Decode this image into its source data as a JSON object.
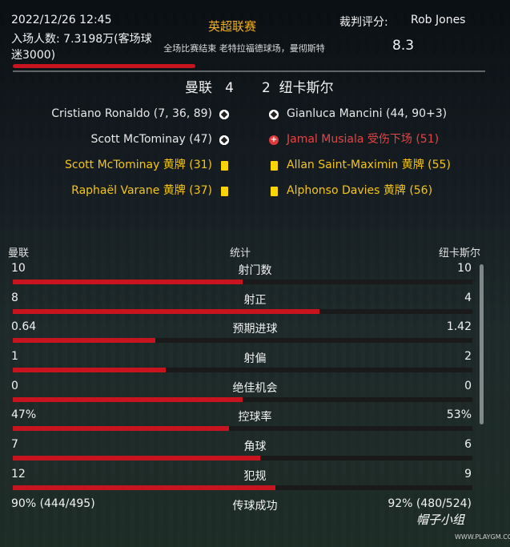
{
  "header": {
    "date_time": "2022/12/26 12:45",
    "attendance": "入场人数: 7.3198万(客场球迷3000)",
    "competition": "英超联赛",
    "subtitle": "全场比赛结束 老特拉福德球场，曼彻斯特",
    "referee_label": "裁判评分:",
    "referee_name": "Rob Jones",
    "referee_rating": "8.3"
  },
  "score": {
    "home_team": "曼联",
    "home_goals": "4",
    "away_goals": "2",
    "away_team": "纽卡斯尔"
  },
  "events": {
    "home": [
      {
        "text": "Cristiano Ronaldo (7, 36, 89)",
        "type": "goal-icon"
      },
      {
        "text": "Scott McTominay (47)",
        "type": "goal-icon"
      },
      {
        "text": "Scott McTominay 黄牌 (31)",
        "type": "yellow-card-icon"
      },
      {
        "text": "Raphaël Varane 黄牌 (37)",
        "type": "yellow-card-icon"
      }
    ],
    "away": [
      {
        "text": "Gianluca Mancini (44, 90+3)",
        "type": "goal-icon"
      },
      {
        "text": "Jamal Musiala 受伤下场 (51)",
        "type": "injury-icon"
      },
      {
        "text": "Allan Saint-Maximin 黄牌 (55)",
        "type": "yellow-card-icon"
      },
      {
        "text": "Alphonso Davies 黄牌 (56)",
        "type": "yellow-card-icon"
      }
    ]
  },
  "stats": {
    "home_label": "曼联",
    "title": "统计",
    "away_label": "纽卡斯尔",
    "rows": [
      {
        "label": "射门数",
        "home": "10",
        "away": "10",
        "home_share": 0.5
      },
      {
        "label": "射正",
        "home": "8",
        "away": "4",
        "home_share": 0.667
      },
      {
        "label": "预期进球",
        "home": "0.64",
        "away": "1.42",
        "home_share": 0.31
      },
      {
        "label": "射偏",
        "home": "1",
        "away": "2",
        "home_share": 0.333
      },
      {
        "label": "绝佳机会",
        "home": "0",
        "away": "0",
        "home_share": 0.5
      },
      {
        "label": "控球率",
        "home": "47%",
        "away": "53%",
        "home_share": 0.47
      },
      {
        "label": "角球",
        "home": "7",
        "away": "6",
        "home_share": 0.538
      },
      {
        "label": "犯规",
        "home": "12",
        "away": "9",
        "home_share": 0.571
      },
      {
        "label": "传球成功",
        "home": "90% (444/495)",
        "away": "92% (480/524)",
        "home_share": null
      }
    ]
  },
  "watermark": {
    "text": "帽子小组",
    "url": "WWW.PLAYGM.CC"
  },
  "colors": {
    "accent": "#c8141e",
    "competition": "#f0b020",
    "yellow_card": "#f5c518",
    "injury": "#e84343"
  }
}
